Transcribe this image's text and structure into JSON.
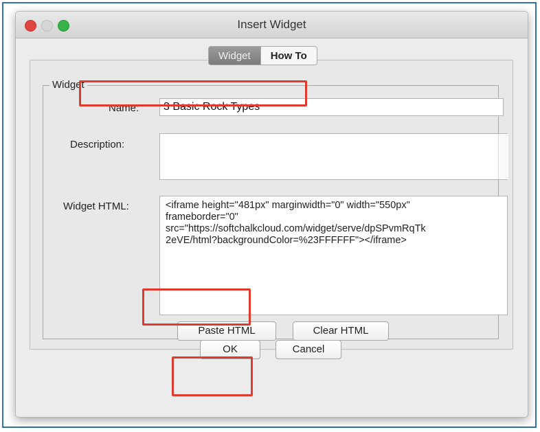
{
  "window": {
    "title": "Insert Widget"
  },
  "tabs": [
    {
      "label": "Widget",
      "active": true
    },
    {
      "label": "How To",
      "active": false
    }
  ],
  "group": {
    "legend": "Widget"
  },
  "fields": {
    "name_label": "Name:",
    "name_value": "3 Basic Rock Types",
    "description_label": "Description:",
    "description_value": "",
    "html_label": "Widget HTML:",
    "html_value": "<iframe height=\"481px\" marginwidth=\"0\" width=\"550px\"\nframeborder=\"0\"\nsrc=\"https://softchalkcloud.com/widget/serve/dpSPvmRqTk\n2eVE/html?backgroundColor=%23FFFFFF\"></iframe>"
  },
  "buttons": {
    "paste_html": "Paste HTML",
    "clear_html": "Clear HTML",
    "ok": "OK",
    "cancel": "Cancel"
  },
  "colors": {
    "frame_border": "#2f6fb3",
    "highlight": "#e03a2f",
    "close_light": "#e0443e",
    "zoom_light": "#38b34a"
  }
}
